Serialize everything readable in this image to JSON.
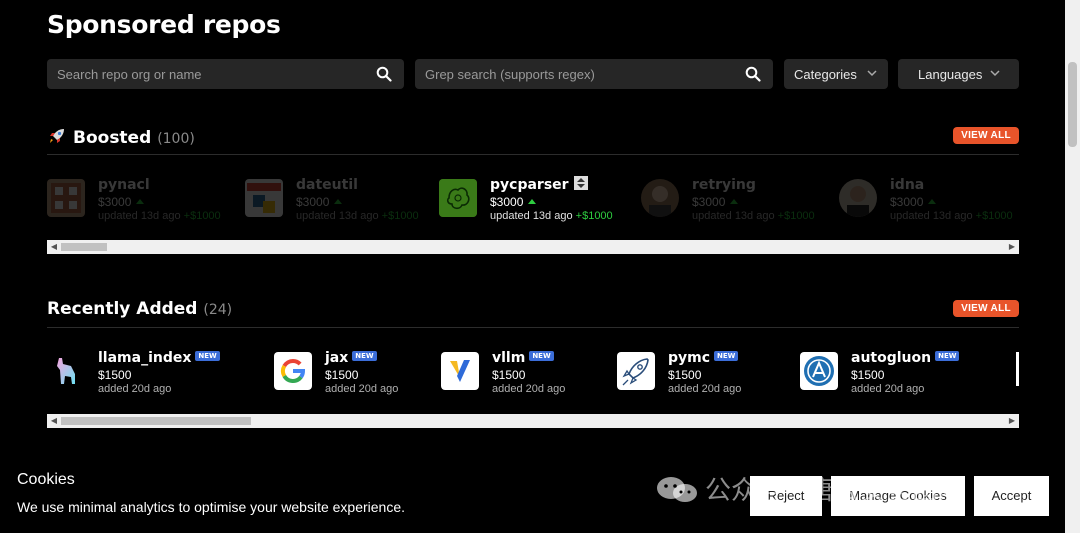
{
  "page": {
    "title": "Sponsored repos"
  },
  "search": {
    "repo_placeholder": "Search repo org or name",
    "grep_placeholder": "Grep search (supports regex)"
  },
  "filters": {
    "categories": "Categories",
    "languages": "Languages"
  },
  "boosted": {
    "title": "Boosted",
    "count": "(100)",
    "view_all": "VIEW ALL",
    "items": [
      {
        "name": "pynacl",
        "price": "$3000",
        "status": "updated 13d ago",
        "boost": "+$1000"
      },
      {
        "name": "dateutil",
        "price": "$3000",
        "status": "updated 13d ago",
        "boost": "+$1000"
      },
      {
        "name": "pycparser",
        "price": "$3000",
        "status": "updated 13d ago",
        "boost": "+$1000"
      },
      {
        "name": "retrying",
        "price": "$3000",
        "status": "updated 13d ago",
        "boost": "+$1000"
      },
      {
        "name": "idna",
        "price": "$3000",
        "status": "updated 13d ago",
        "boost": "+$1000"
      }
    ]
  },
  "recent": {
    "title": "Recently Added",
    "count": "(24)",
    "view_all": "VIEW ALL",
    "items": [
      {
        "name": "llama_index",
        "badge": "NEW",
        "price": "$1500",
        "status": "added 20d ago"
      },
      {
        "name": "jax",
        "badge": "NEW",
        "price": "$1500",
        "status": "added 20d ago"
      },
      {
        "name": "vllm",
        "badge": "NEW",
        "price": "$1500",
        "status": "added 20d ago"
      },
      {
        "name": "pymc",
        "badge": "NEW",
        "price": "$1500",
        "status": "added 20d ago"
      },
      {
        "name": "autogluon",
        "badge": "NEW",
        "price": "$1500",
        "status": "added 20d ago"
      }
    ]
  },
  "cookies": {
    "title": "Cookies",
    "description": "We use minimal analytics to optimise your website experience.",
    "reject": "Reject",
    "manage": "Manage Cookies",
    "accept": "Accept"
  },
  "watermark": {
    "text": "公众号 · 唐去安全团队"
  },
  "colors": {
    "accent": "#e8542a",
    "badge": "#3b6dd8",
    "up": "#2ecc40"
  }
}
